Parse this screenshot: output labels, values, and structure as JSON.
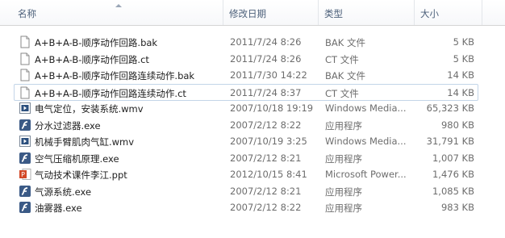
{
  "columns": {
    "name": "名称",
    "date": "修改日期",
    "type": "类型",
    "size": "大小"
  },
  "files": [
    {
      "name": "A+B+A-B-顺序动作回路.bak",
      "date": "2011/7/24 8:26",
      "type": "BAK 文件",
      "size": "5 KB",
      "icon": "document-icon"
    },
    {
      "name": "A+B+A-B-顺序动作回路.ct",
      "date": "2011/7/24 8:26",
      "type": "CT 文件",
      "size": "5 KB",
      "icon": "document-icon"
    },
    {
      "name": "A+B+A-B-顺序动作回路连续动作.bak",
      "date": "2011/7/30 14:22",
      "type": "BAK 文件",
      "size": "14 KB",
      "icon": "document-icon"
    },
    {
      "name": "A+B+A-B-顺序动作回路连续动作.ct",
      "date": "2011/7/24 8:37",
      "type": "CT 文件",
      "size": "14 KB",
      "icon": "document-icon"
    },
    {
      "name": "电气定位，安装系统.wmv",
      "date": "2007/10/18 19:19",
      "type": "Windows Media...",
      "size": "65,323 KB",
      "icon": "video-file-icon"
    },
    {
      "name": "分水过滤器.exe",
      "date": "2007/2/12 8:22",
      "type": "应用程序",
      "size": "980 KB",
      "icon": "flash-exe-icon"
    },
    {
      "name": "机械手臂肌肉气缸.wmv",
      "date": "2007/10/19 3:25",
      "type": "Windows Media...",
      "size": "31,791 KB",
      "icon": "video-file-icon"
    },
    {
      "name": "空气压缩机原理.exe",
      "date": "2007/2/12 8:21",
      "type": "应用程序",
      "size": "1,007 KB",
      "icon": "flash-exe-icon"
    },
    {
      "name": "气动技术课件李江.ppt",
      "date": "2012/10/15 8:41",
      "type": "Microsoft Power...",
      "size": "1,476 KB",
      "icon": "powerpoint-icon"
    },
    {
      "name": "气源系统.exe",
      "date": "2007/2/12 8:21",
      "type": "应用程序",
      "size": "1,085 KB",
      "icon": "flash-exe-icon"
    },
    {
      "name": "油雾器.exe",
      "date": "2007/2/12 8:22",
      "type": "应用程序",
      "size": "983 KB",
      "icon": "flash-exe-icon"
    }
  ],
  "selected_index": 3,
  "colors": {
    "header_text": "#4c607a",
    "selected_border": "#c3d5e8",
    "flash_red": "#c8202a",
    "ppt_orange": "#d24726",
    "video_blue": "#2b4f7d"
  }
}
